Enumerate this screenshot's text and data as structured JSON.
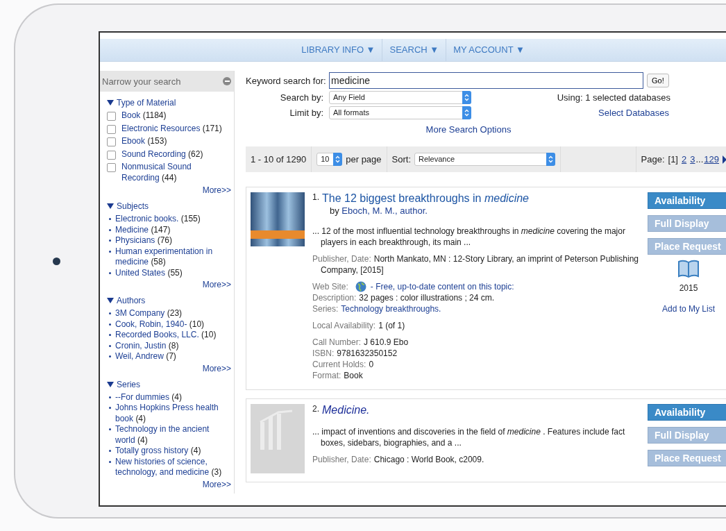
{
  "nav": [
    {
      "label": "LIBRARY INFO ▼"
    },
    {
      "label": "SEARCH ▼"
    },
    {
      "label": "MY ACCOUNT ▼"
    }
  ],
  "sidebar": {
    "title": "Narrow your search",
    "sections": [
      {
        "title": "Type of Material",
        "expanded": true,
        "kind": "checkbox",
        "more": "More>>",
        "items": [
          {
            "label": "Book",
            "count": "(1184)",
            "checked": false
          },
          {
            "label": "Electronic Resources",
            "count": "(171)",
            "checked": false
          },
          {
            "label": "Ebook",
            "count": "(153)",
            "checked": false
          },
          {
            "label": "Sound Recording",
            "count": "(62)",
            "checked": false
          },
          {
            "label": "Nonmusical Sound Recording",
            "count": "(44)",
            "checked": false
          }
        ]
      },
      {
        "title": "Subjects",
        "expanded": true,
        "kind": "bullet",
        "more": "More>>",
        "items": [
          {
            "label": "Electronic books.",
            "count": "(155)"
          },
          {
            "label": "Medicine",
            "count": "(147)"
          },
          {
            "label": "Physicians",
            "count": "(76)"
          },
          {
            "label": "Human experimentation in medicine",
            "count": "(58)"
          },
          {
            "label": "United States",
            "count": "(55)"
          }
        ]
      },
      {
        "title": "Authors",
        "expanded": true,
        "kind": "bullet",
        "more": "More>>",
        "items": [
          {
            "label": "3M Company",
            "count": "(23)"
          },
          {
            "label": "Cook, Robin, 1940-",
            "count": "(10)"
          },
          {
            "label": "Recorded Books, LLC.",
            "count": "(10)"
          },
          {
            "label": "Cronin, Justin",
            "count": "(8)"
          },
          {
            "label": "Weil, Andrew",
            "count": "(7)"
          }
        ]
      },
      {
        "title": "Series",
        "expanded": true,
        "kind": "bullet",
        "more": "More>>",
        "items": [
          {
            "label": "--For dummies",
            "count": "(4)"
          },
          {
            "label": "Johns Hopkins Press health book",
            "count": "(4)"
          },
          {
            "label": "Technology in the ancient world",
            "count": "(4)"
          },
          {
            "label": "Totally gross history",
            "count": "(4)"
          },
          {
            "label": "New histories of science, technology, and medicine",
            "count": "(3)"
          }
        ]
      }
    ]
  },
  "search": {
    "keyword_label": "Keyword search for:",
    "keyword": "medicine",
    "go": "Go!",
    "search_by_label": "Search by:",
    "search_by": "Any Field",
    "limit_by_label": "Limit by:",
    "limit_by": "All formats",
    "using": "Using: 1 selected databases",
    "select_databases": "Select Databases",
    "more_options": "More Search Options"
  },
  "results_bar": {
    "range": "1 - 10 of 1290",
    "per_page": "10",
    "per_page_label": "per page",
    "sort_label": "Sort:",
    "sort": "Relevance",
    "page_label": "Page:",
    "pages": [
      {
        "kind": "page",
        "label": "[1]",
        "selected": true
      },
      {
        "kind": "page",
        "label": "2",
        "selected": false
      },
      {
        "kind": "page",
        "label": "3",
        "selected": false
      },
      {
        "kind": "gap",
        "label": "..."
      },
      {
        "kind": "page",
        "label": "129",
        "selected": false
      }
    ]
  },
  "results": [
    {
      "number": "1.",
      "title": "The 12 biggest breakthroughs in *medicine*",
      "italic_title": false,
      "thumbnail": {
        "kind": "cover"
      },
      "author_prefix": "by",
      "author": "Eboch, M. M., author.",
      "snippet": "... 12 of the most influential technology breakthroughs in *medicine* covering the major players in each breakthrough, its main ...",
      "groups": [
        [
          {
            "kind": "text",
            "label": "Publisher, Date:",
            "value": "North Mankato, MN : 12-Story Library, an imprint of Peterson Publishing Company, [2015]"
          }
        ],
        [
          {
            "kind": "web",
            "label": "Web Site:",
            "value": "- Free, up-to-date content on this topic:"
          },
          {
            "kind": "text",
            "label": "Description:",
            "value": "32 pages : color illustrations ; 24 cm."
          },
          {
            "kind": "link",
            "label": "Series:",
            "value": "Technology breakthroughs."
          }
        ],
        [
          {
            "kind": "text",
            "label": "Local Availability:",
            "value": "1 (of 1)"
          }
        ],
        [
          {
            "kind": "text",
            "label": "Call Number:",
            "value": "J 610.9 Ebo"
          },
          {
            "kind": "text",
            "label": "ISBN:",
            "value": "9781632350152"
          },
          {
            "kind": "text",
            "label": "Current Holds:",
            "value": "0"
          },
          {
            "kind": "text",
            "label": "Format:",
            "value": "Book"
          }
        ]
      ],
      "buttons": [
        {
          "label": "Availability",
          "primary": true
        },
        {
          "label": "Full Display",
          "primary": false
        },
        {
          "label": "Place Request",
          "primary": false
        }
      ],
      "year": "2015",
      "add_to_list": "Add to My List"
    },
    {
      "number": "2.",
      "title": "Medicine.",
      "italic_title": true,
      "thumbnail": {
        "kind": "none"
      },
      "snippet": "... impact of inventions and discoveries in the field of *medicine* . Features include fact boxes, sidebars, biographies, and a ...",
      "groups": [
        [
          {
            "kind": "text",
            "label": "Publisher, Date:",
            "value": "Chicago : World Book, c2009."
          }
        ]
      ],
      "buttons": [
        {
          "label": "Availability",
          "primary": true
        },
        {
          "label": "Full Display",
          "primary": false
        },
        {
          "label": "Place Request",
          "primary": false
        }
      ]
    }
  ]
}
